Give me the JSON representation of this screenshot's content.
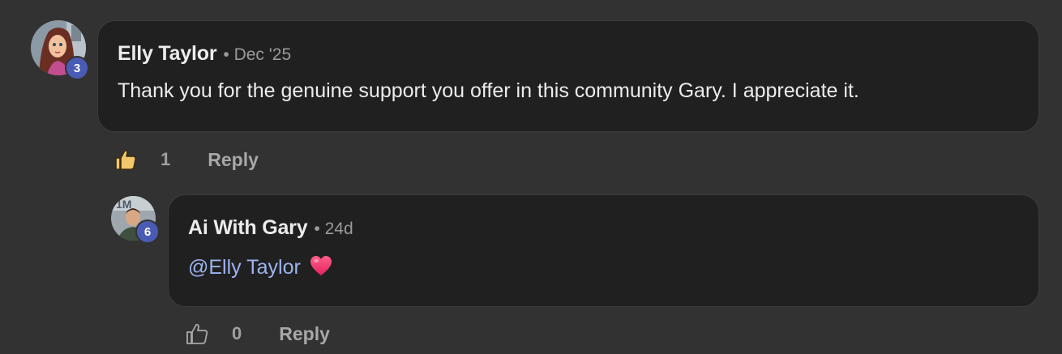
{
  "comment": {
    "author": "Elly Taylor",
    "meta": "• Dec '25",
    "level": "3",
    "text": "Thank you for the genuine support you offer in this community Gary. I appreciate it.",
    "likes": "1",
    "reply_label": "Reply",
    "liked": true
  },
  "reply": {
    "author": "Ai With Gary",
    "meta": "• 24d",
    "level": "6",
    "mention": "@Elly Taylor",
    "emoji_icon": "heart-icon",
    "likes": "0",
    "reply_label": "Reply",
    "liked": false
  },
  "colors": {
    "background": "#323232",
    "bubble": "#202020",
    "badge": "#4a5bb5",
    "mention": "#9db4f0",
    "liked_thumb": "#f2c66d"
  }
}
